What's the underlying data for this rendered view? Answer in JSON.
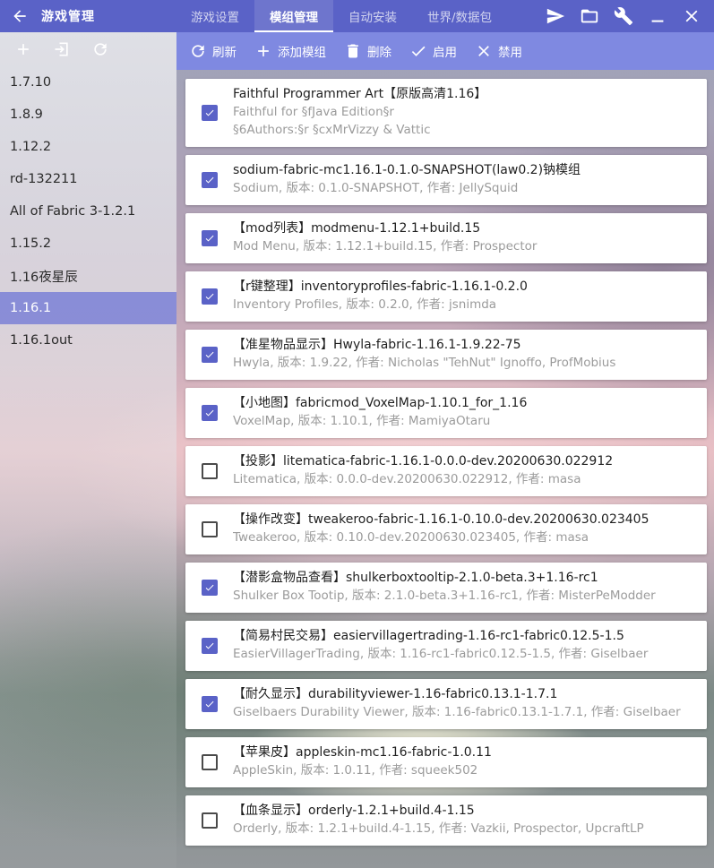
{
  "window": {
    "title": "游戏管理"
  },
  "tabs": [
    {
      "label": "游戏设置"
    },
    {
      "label": "模组管理"
    },
    {
      "label": "自动安装"
    },
    {
      "label": "世界/数据包"
    }
  ],
  "top_actions": [
    "send-icon",
    "folder-icon",
    "wrench-icon",
    "minimize-icon",
    "close-icon"
  ],
  "sidebar": {
    "tools": [
      "plus-icon",
      "import-icon",
      "refresh-icon"
    ],
    "versions": [
      {
        "label": "1.7.10"
      },
      {
        "label": "1.8.9"
      },
      {
        "label": "1.12.2"
      },
      {
        "label": "rd-132211"
      },
      {
        "label": "All of Fabric 3-1.2.1"
      },
      {
        "label": "1.15.2"
      },
      {
        "label": "1.16夜星辰"
      },
      {
        "label": "1.16.1"
      },
      {
        "label": "1.16.1out"
      }
    ],
    "selected": "1.16.1"
  },
  "toolbar": {
    "refresh_label": "刷新",
    "add_label": "添加模组",
    "delete_label": "删除",
    "enable_label": "启用",
    "disable_label": "禁用"
  },
  "mods": [
    {
      "title": "Faithful Programmer Art【原版高清1.16】",
      "line1": "Faithful for §fJava Edition§r",
      "line2": "§6Authors:§r §cxMrVizzy & Vattic",
      "checked": true
    },
    {
      "title": "sodium-fabric-mc1.16.1-0.1.0-SNAPSHOT(law0.2)钠模组",
      "line1": "Sodium, 版本: 0.1.0-SNAPSHOT, 作者: JellySquid",
      "checked": true
    },
    {
      "title": "【mod列表】modmenu-1.12.1+build.15",
      "line1": "Mod Menu, 版本: 1.12.1+build.15, 作者: Prospector",
      "checked": true
    },
    {
      "title": "【r键整理】inventoryprofiles-fabric-1.16.1-0.2.0",
      "line1": "Inventory Profiles, 版本: 0.2.0, 作者: jsnimda",
      "checked": true
    },
    {
      "title": "【准星物品显示】Hwyla-fabric-1.16.1-1.9.22-75",
      "line1": "Hwyla, 版本: 1.9.22, 作者: Nicholas \"TehNut\" Ignoffo, ProfMobius",
      "checked": true
    },
    {
      "title": "【小地图】fabricmod_VoxelMap-1.10.1_for_1.16",
      "line1": "VoxelMap, 版本: 1.10.1, 作者: MamiyaOtaru",
      "checked": true
    },
    {
      "title": "【投影】litematica-fabric-1.16.1-0.0.0-dev.20200630.022912",
      "line1": "Litematica, 版本: 0.0.0-dev.20200630.022912, 作者: masa",
      "checked": false
    },
    {
      "title": "【操作改变】tweakeroo-fabric-1.16.1-0.10.0-dev.20200630.023405",
      "line1": "Tweakeroo, 版本: 0.10.0-dev.20200630.023405, 作者: masa",
      "checked": false
    },
    {
      "title": "【潜影盒物品查看】shulkerboxtooltip-2.1.0-beta.3+1.16-rc1",
      "line1": "Shulker Box Tootip, 版本: 2.1.0-beta.3+1.16-rc1, 作者: MisterPeModder",
      "checked": true
    },
    {
      "title": "【简易村民交易】easiervillagertrading-1.16-rc1-fabric0.12.5-1.5",
      "line1": "EasierVillagerTrading, 版本: 1.16-rc1-fabric0.12.5-1.5, 作者: Giselbaer",
      "checked": true
    },
    {
      "title": "【耐久显示】durabilityviewer-1.16-fabric0.13.1-1.7.1",
      "line1": "Giselbaers Durability Viewer, 版本: 1.16-fabric0.13.1-1.7.1, 作者: Giselbaer",
      "checked": true
    },
    {
      "title": "【苹果皮】appleskin-mc1.16-fabric-1.0.11",
      "line1": "AppleSkin, 版本: 1.0.11, 作者: squeek502",
      "checked": false
    },
    {
      "title": "【血条显示】orderly-1.2.1+build.4-1.15",
      "line1": "Orderly, 版本: 1.2.1+build.4-1.15, 作者: Vazkii, Prospector, UpcraftLP",
      "checked": false
    }
  ],
  "colors": {
    "primary": "#5a62c7",
    "toolbar": "#7f89e1",
    "selected": "#777ed6"
  }
}
